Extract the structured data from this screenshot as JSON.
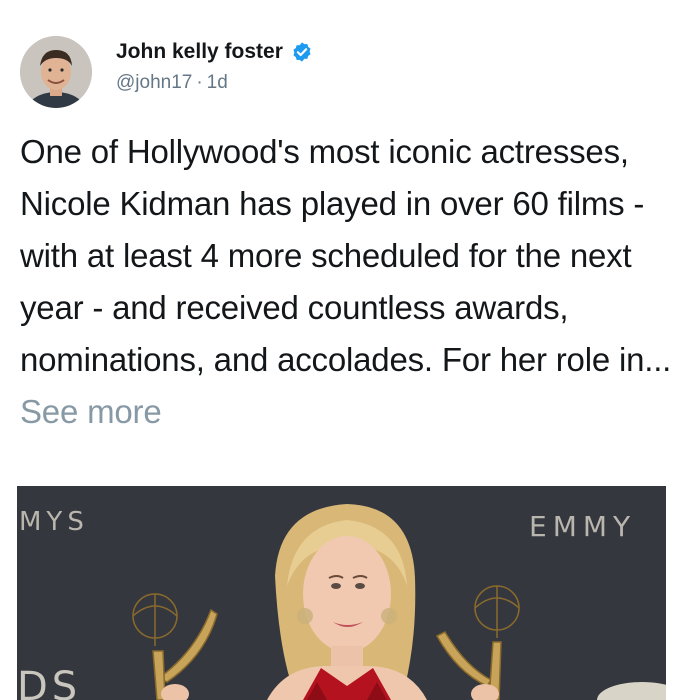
{
  "author": {
    "display_name": "John kelly foster",
    "verified": true,
    "handle": "@john17",
    "separator": "·",
    "timestamp": "1d",
    "avatar_icon": "user-avatar-photo"
  },
  "tweet": {
    "text": "One of Hollywood's most iconic actresses, Nicole Kidman has played in over 60 films - with at least 4 more scheduled for the next year - and received countless awards, nominations, and accolades. For her role in...",
    "see_more": "See more"
  },
  "media": {
    "backdrop_left_text": "MYS",
    "backdrop_right_text": "EMMY",
    "backdrop_bottom_left_text": "DS",
    "subject": "photo"
  },
  "colors": {
    "verified": "#1d9bf0",
    "muted": "#657786",
    "see_more": "#8899a6",
    "text": "#14171a"
  }
}
